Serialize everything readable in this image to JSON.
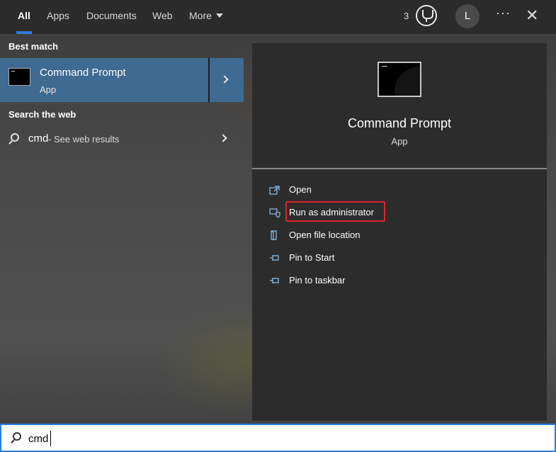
{
  "tabs": [
    {
      "label": "All",
      "active": true
    },
    {
      "label": "Apps"
    },
    {
      "label": "Documents"
    },
    {
      "label": "Web"
    },
    {
      "label": "More"
    }
  ],
  "topbar": {
    "reward_points": "3",
    "avatar_initial": "L",
    "more_options": "···",
    "close": "✕"
  },
  "sections": {
    "best_match": "Best match",
    "search_web": "Search the web"
  },
  "best_match_item": {
    "name": "Command Prompt",
    "type": "App"
  },
  "web_result": {
    "query": "cmd",
    "suffix": "- See web results"
  },
  "details": {
    "name": "Command Prompt",
    "type": "App",
    "actions": [
      {
        "label": "Open",
        "icon": "open-icon"
      },
      {
        "label": "Run as administrator",
        "icon": "shield-icon",
        "highlighted": true
      },
      {
        "label": "Open file location",
        "icon": "file-location-icon"
      },
      {
        "label": "Pin to Start",
        "icon": "pin-icon"
      },
      {
        "label": "Pin to taskbar",
        "icon": "pin-icon"
      }
    ]
  },
  "search": {
    "value": "cmd"
  },
  "colors": {
    "accent": "#2b7de1",
    "selection": "#3f6a91",
    "highlight_box": "#e0232a",
    "action_icon": "#8fc1ea"
  }
}
